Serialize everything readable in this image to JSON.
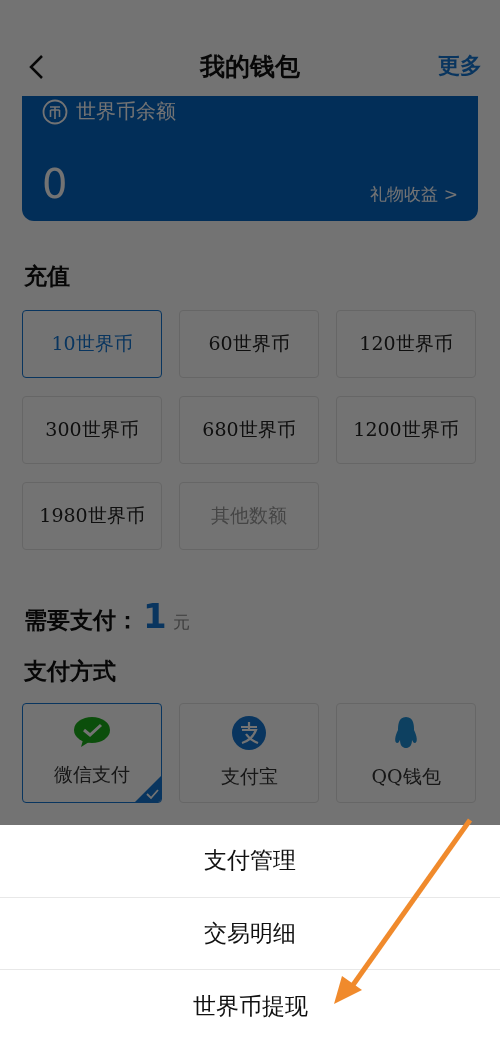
{
  "header": {
    "title": "我的钱包",
    "action": "更多"
  },
  "balance": {
    "label": "世界币余额",
    "amount": "0",
    "link": "礼物收益 >"
  },
  "recharge": {
    "title": "充值",
    "options": [
      {
        "label": "10世界币",
        "selected": true
      },
      {
        "label": "60世界币",
        "selected": false
      },
      {
        "label": "120世界币",
        "selected": false
      },
      {
        "label": "300世界币",
        "selected": false
      },
      {
        "label": "680世界币",
        "selected": false
      },
      {
        "label": "1200世界币",
        "selected": false
      },
      {
        "label": "1980世界币",
        "selected": false
      },
      {
        "label": "其他数额",
        "selected": false,
        "kind": "custom"
      }
    ]
  },
  "payment": {
    "label": "需要支付：",
    "amount": "1",
    "unit": "元"
  },
  "methods": {
    "title": "支付方式",
    "items": [
      {
        "label": "微信支付",
        "kind": "wechat",
        "selected": true
      },
      {
        "label": "支付宝",
        "kind": "alipay",
        "selected": false
      },
      {
        "label": "QQ钱包",
        "kind": "qq",
        "selected": false
      }
    ]
  },
  "sheet": {
    "items": [
      "支付管理",
      "交易明细",
      "世界币提现"
    ]
  }
}
